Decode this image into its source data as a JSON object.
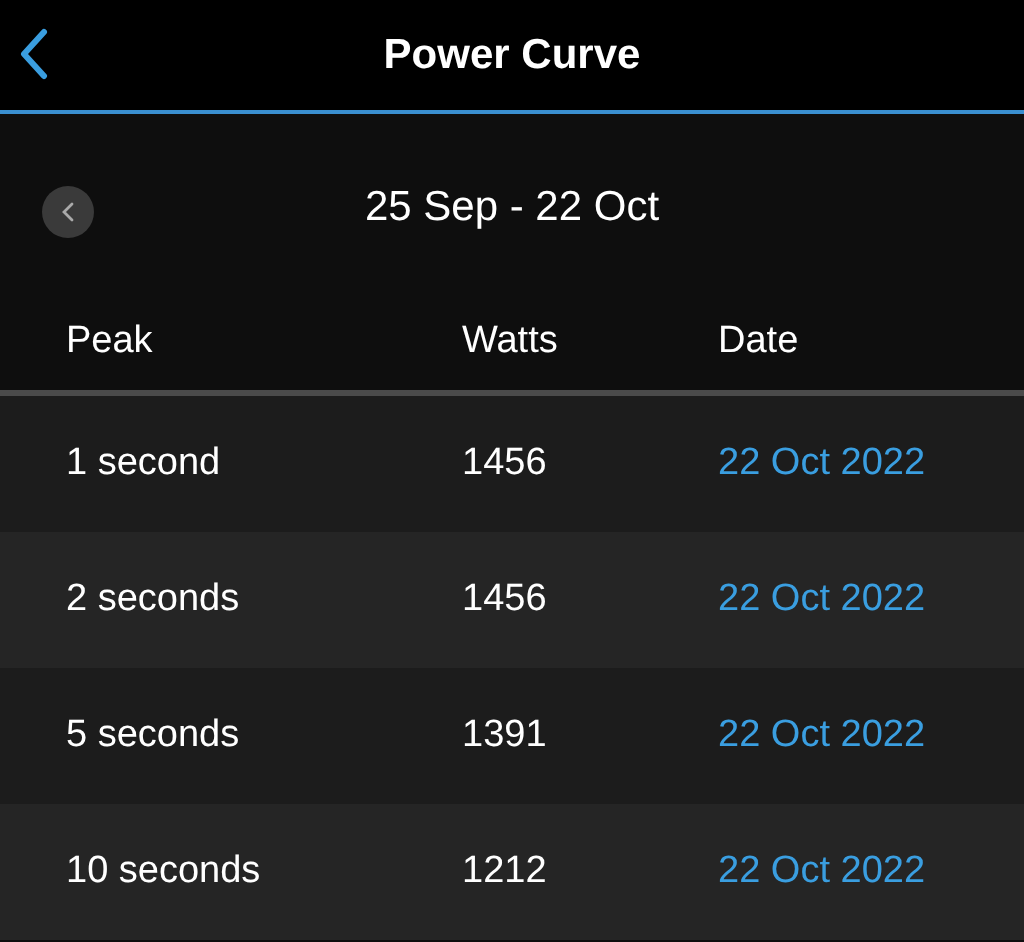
{
  "header": {
    "title": "Power Curve"
  },
  "range": {
    "label": "25 Sep - 22 Oct"
  },
  "table": {
    "columns": [
      "Peak",
      "Watts",
      "Date"
    ],
    "rows": [
      {
        "peak": "1 second",
        "watts": "1456",
        "date": "22 Oct 2022"
      },
      {
        "peak": "2 seconds",
        "watts": "1456",
        "date": "22 Oct 2022"
      },
      {
        "peak": "5 seconds",
        "watts": "1391",
        "date": "22 Oct 2022"
      },
      {
        "peak": "10 seconds",
        "watts": "1212",
        "date": "22 Oct 2022"
      }
    ]
  }
}
